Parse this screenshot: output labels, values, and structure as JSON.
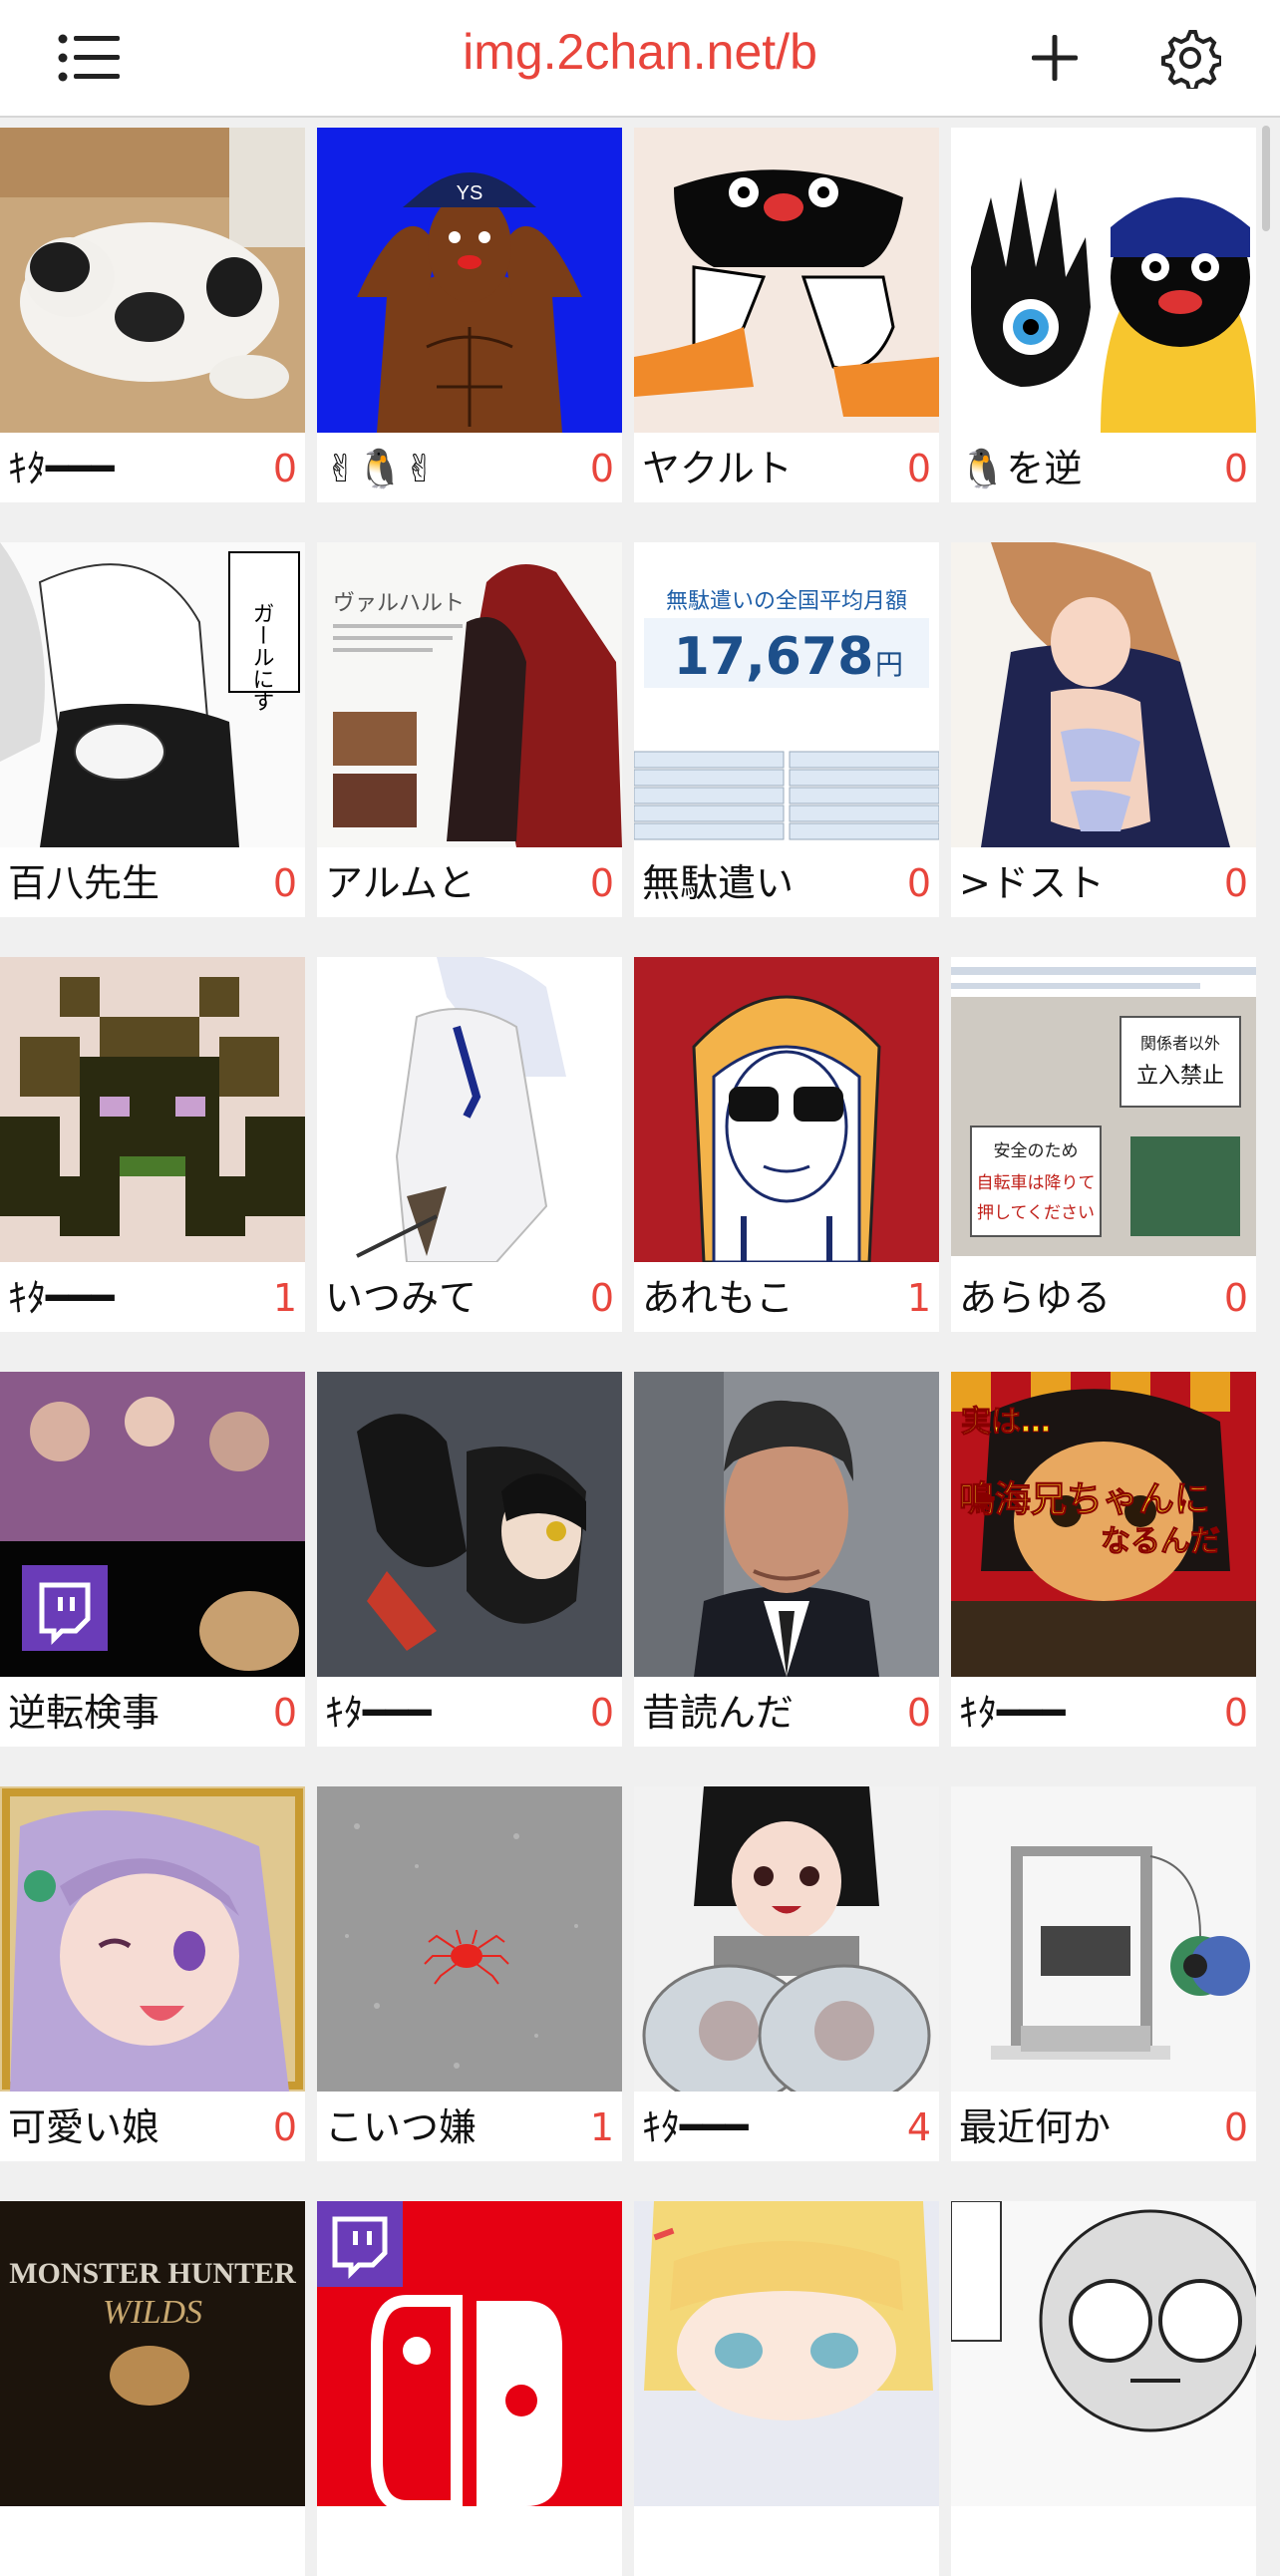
{
  "header": {
    "title": "img.2chan.net/b",
    "menu_icon": "list-icon",
    "add_icon": "plus-icon",
    "settings_icon": "gear-icon",
    "accent_color": "#e8453c"
  },
  "threads": [
    {
      "title": "ｷﾀ━━━",
      "count": "0",
      "thumb": "cat-in-box"
    },
    {
      "title": "✌🐧✌",
      "count": "0",
      "thumb": "muscle-man-cap"
    },
    {
      "title": "ヤクルト",
      "count": "0",
      "thumb": "penguin-drawing"
    },
    {
      "title": "🐧を逆",
      "count": "0",
      "thumb": "penguin-hand-eye"
    },
    {
      "title": "百八先生",
      "count": "0",
      "thumb": "manga-bunny-girl"
    },
    {
      "title": "アルムと",
      "count": "0",
      "thumb": "armored-character-sheet"
    },
    {
      "title": "無駄遣い",
      "count": "0",
      "thumb": "infographic-spending"
    },
    {
      "title": ">ドスト",
      "count": "0",
      "thumb": "anime-girl-uniform"
    },
    {
      "title": "ｷﾀ━━━",
      "count": "1",
      "thumb": "pixel-monster"
    },
    {
      "title": "いつみて",
      "count": "0",
      "thumb": "anime-white-coat"
    },
    {
      "title": "あれもこ",
      "count": "1",
      "thumb": "hooded-sunglasses-man"
    },
    {
      "title": "あらゆる",
      "count": "0",
      "thumb": "tweet-screenshot-signs"
    },
    {
      "title": "逆転検事",
      "count": "0",
      "thumb": "game-stream-twitch"
    },
    {
      "title": "ｷﾀ━━━",
      "count": "0",
      "thumb": "anime-figure-dark"
    },
    {
      "title": "昔読んだ",
      "count": "0",
      "thumb": "man-in-suit"
    },
    {
      "title": "ｷﾀ━━━",
      "count": "0",
      "thumb": "anime-boy-yellow-text"
    },
    {
      "title": "可愛い娘",
      "count": "0",
      "thumb": "anime-lilac-hair"
    },
    {
      "title": "こいつ嫌",
      "count": "1",
      "thumb": "red-mite"
    },
    {
      "title": "ｷﾀ━━━",
      "count": "4",
      "thumb": "anime-girl-glass"
    },
    {
      "title": "最近何か",
      "count": "0",
      "thumb": "3d-printer"
    },
    {
      "title": "",
      "count": "",
      "thumb": "monster-hunter-wilds"
    },
    {
      "title": "",
      "count": "",
      "thumb": "switch-logo-twitch"
    },
    {
      "title": "",
      "count": "",
      "thumb": "anime-blonde-girl"
    },
    {
      "title": "",
      "count": "",
      "thumb": "manga-mask"
    }
  ],
  "thumb_text": {
    "infographic_heading": "無駄遣いの全国平均月額",
    "infographic_amount": "17,678",
    "infographic_unit": "円",
    "signs_line1": "関係者以外",
    "signs_line2": "立入禁止",
    "signs_line3": "安全のため",
    "signs_line4": "自転車は降りて",
    "signs_line5": "押してください",
    "yellow_text1": "実は…",
    "yellow_text2": "鳴海兄ちゃんに",
    "yellow_text3": "なるんだ",
    "mh_line1": "MONSTER HUNTER",
    "mh_line2": "WILDS",
    "cap_logo": "YS",
    "character_name": "ヴァルハルト",
    "manga_bubble": "ガールにす"
  }
}
